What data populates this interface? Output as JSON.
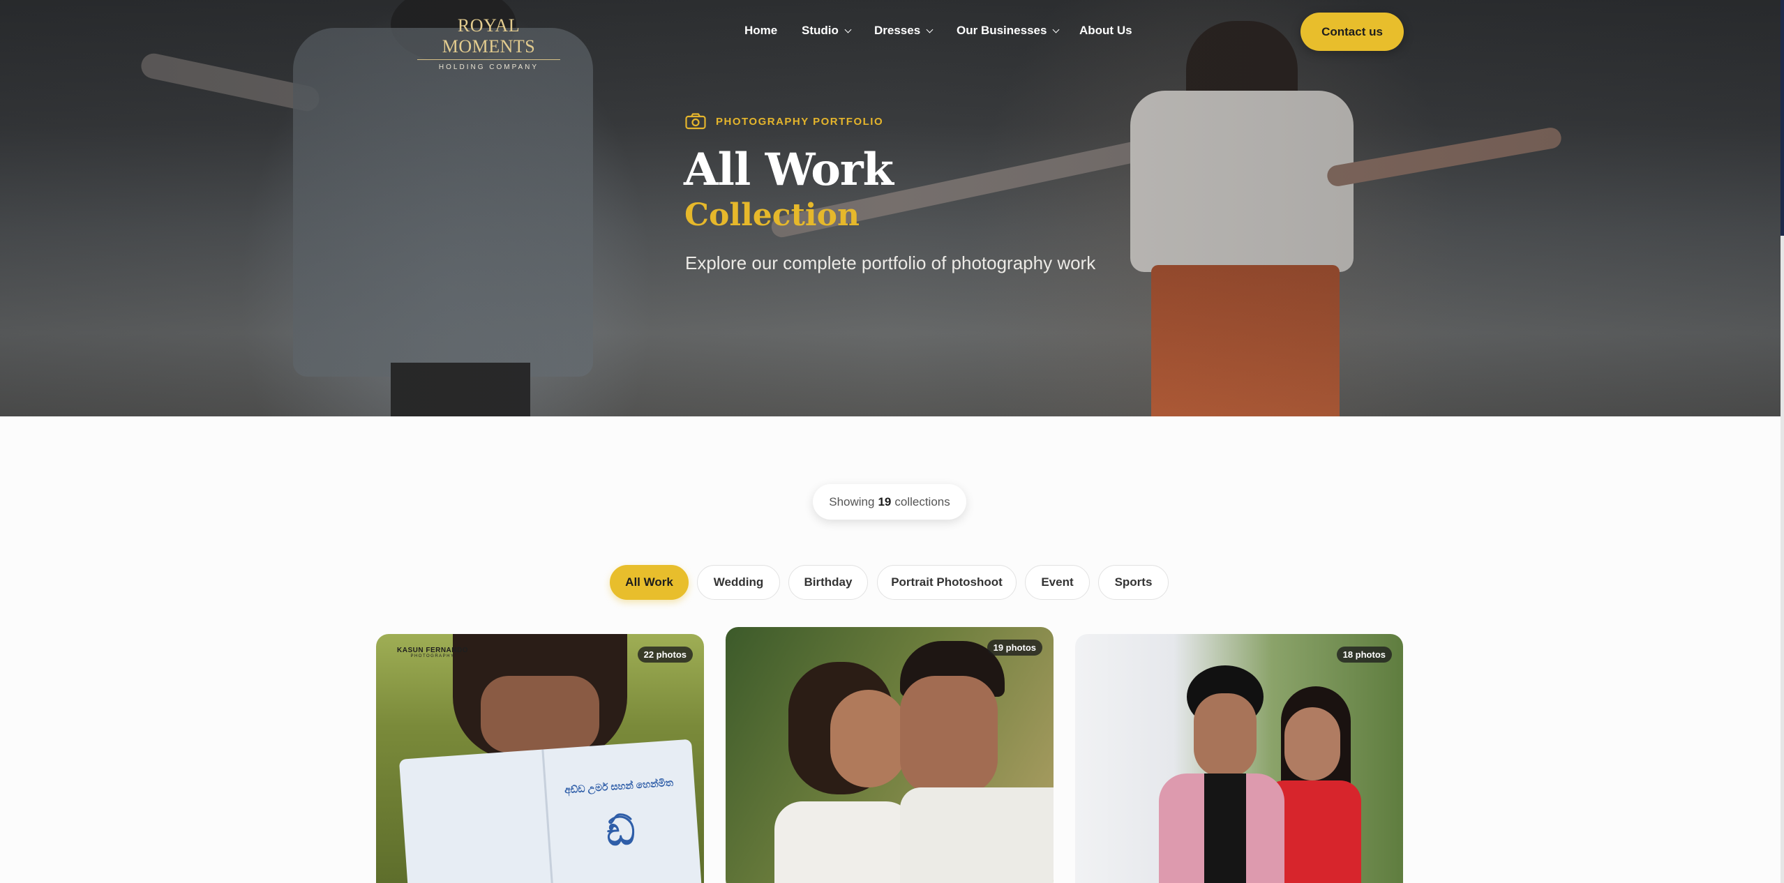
{
  "header": {
    "logo": {
      "name": "ROYAL MOMENTS",
      "tagline": "HOLDING COMPANY"
    },
    "nav": [
      {
        "label": "Home",
        "has_dropdown": false
      },
      {
        "label": "Studio",
        "has_dropdown": true
      },
      {
        "label": "Dresses",
        "has_dropdown": true
      },
      {
        "label": "Our Businesses",
        "has_dropdown": true
      },
      {
        "label": "About Us",
        "has_dropdown": false
      }
    ],
    "contact_label": "Contact us"
  },
  "hero": {
    "eyebrow_icon": "camera-icon",
    "eyebrow": "PHOTOGRAPHY PORTFOLIO",
    "title": "All Work",
    "subtitle": "Collection",
    "description": "Explore our complete portfolio of photography work"
  },
  "summary": {
    "prefix": "Showing",
    "count": "19",
    "suffix": "collections"
  },
  "filters": [
    {
      "label": "All Work",
      "active": true
    },
    {
      "label": "Wedding",
      "active": false
    },
    {
      "label": "Birthday",
      "active": false
    },
    {
      "label": "Portrait Photoshoot",
      "active": false
    },
    {
      "label": "Event",
      "active": false
    },
    {
      "label": "Sports",
      "active": false
    }
  ],
  "cards": [
    {
      "badge": "22 photos",
      "watermark": "KASUN FERNANDO",
      "watermark_sub": "PHOTOGRAPHY"
    },
    {
      "badge": "19 photos"
    },
    {
      "badge": "18 photos"
    }
  ],
  "colors": {
    "accent": "#e8be2c",
    "accent_text": "#e6b82b",
    "hero_text": "#ffffff",
    "scroll_thumb": "#1e2a4a"
  }
}
